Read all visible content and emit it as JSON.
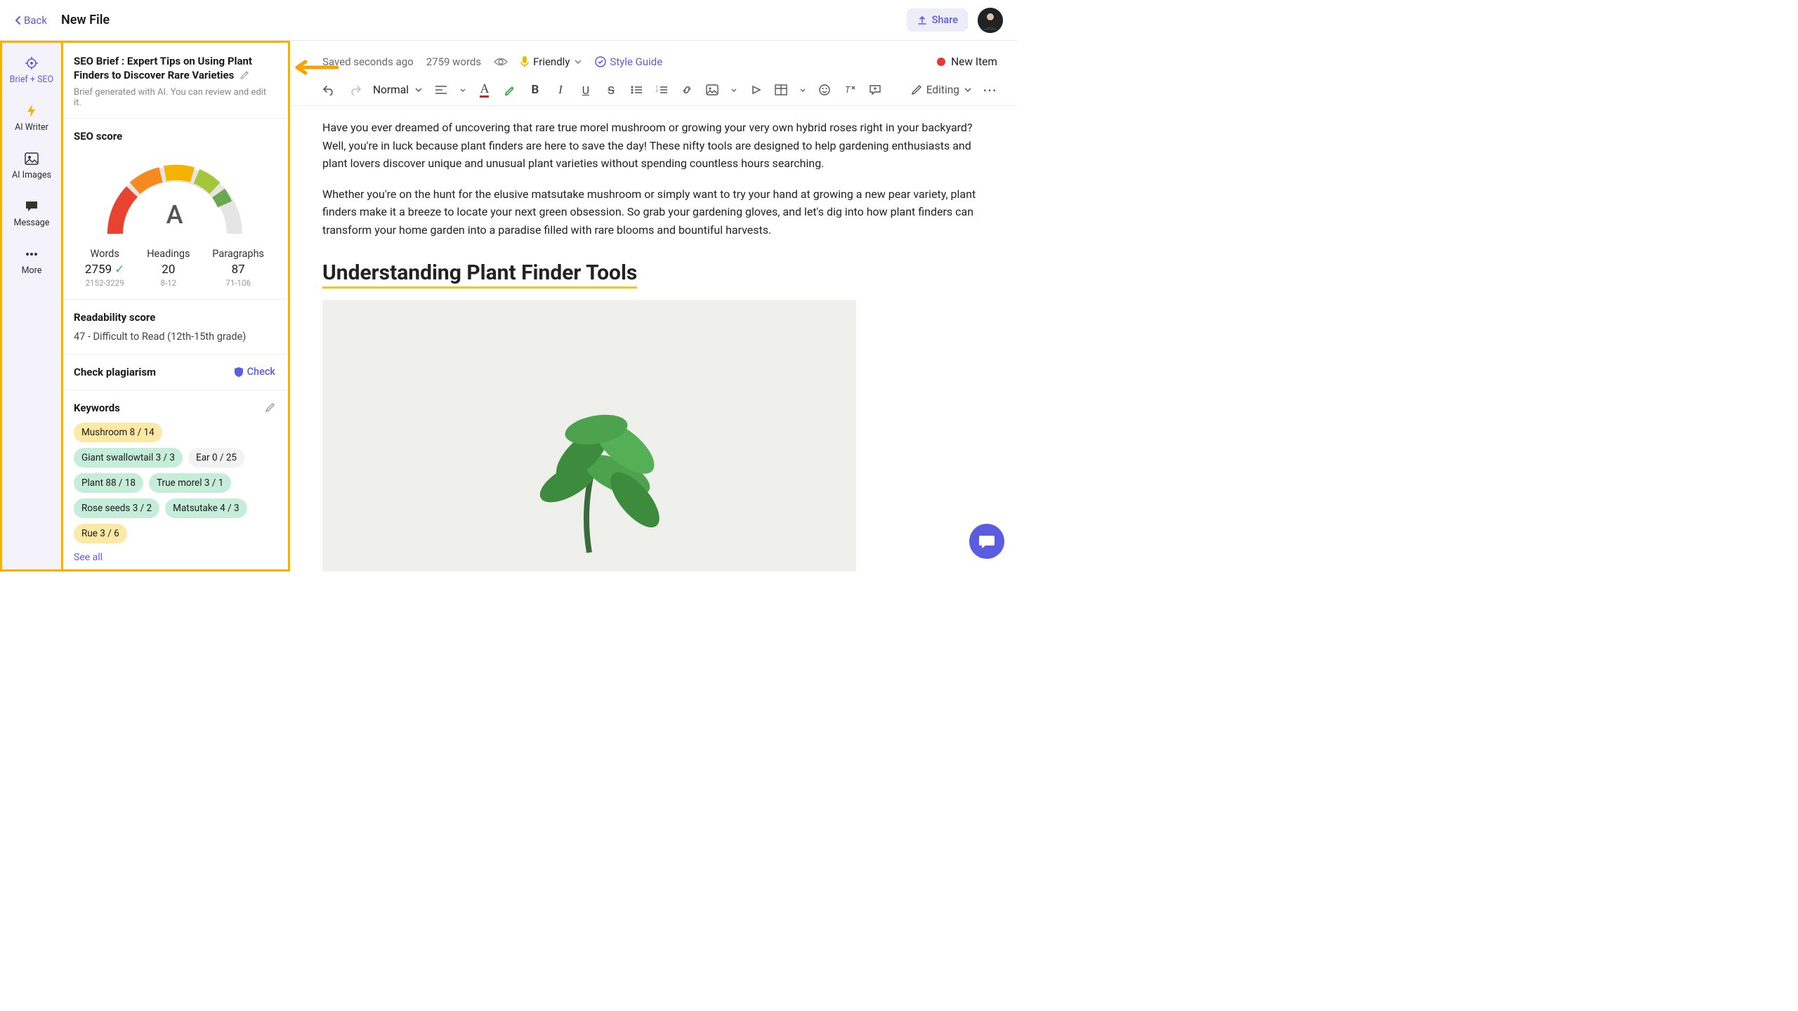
{
  "header": {
    "back": "Back",
    "title": "New File",
    "share": "Share"
  },
  "rail": {
    "items": [
      {
        "label": "Brief + SEO"
      },
      {
        "label": "AI Writer"
      },
      {
        "label": "AI Images"
      },
      {
        "label": "Message"
      },
      {
        "label": "More"
      }
    ]
  },
  "brief": {
    "title": "SEO Brief : Expert Tips on Using Plant Finders to Discover Rare Varieties",
    "sub": "Brief generated with AI. You can review and edit it."
  },
  "seo": {
    "title": "SEO score",
    "grade": "A",
    "stats": {
      "words": {
        "label": "Words",
        "value": "2759",
        "range": "2152-3229",
        "ok": true
      },
      "headings": {
        "label": "Headings",
        "value": "20",
        "range": "8-12"
      },
      "paragraphs": {
        "label": "Paragraphs",
        "value": "87",
        "range": "71-106"
      }
    }
  },
  "readability": {
    "title": "Readability score",
    "value": "47 - Difficult to Read (12th-15th grade)"
  },
  "plagiarism": {
    "title": "Check plagiarism",
    "action": "Check"
  },
  "keywords": {
    "title": "Keywords",
    "items": [
      {
        "text": "Mushroom",
        "count": "8 / 14",
        "cls": "kw-o"
      },
      {
        "text": "Giant swallowtail",
        "count": "3 / 3",
        "cls": "kw-g"
      },
      {
        "text": "Ear",
        "count": "0 / 25",
        "cls": "kw-n"
      },
      {
        "text": "Plant",
        "count": "88 / 18",
        "cls": "kw-g"
      },
      {
        "text": "True morel",
        "count": "3 / 1",
        "cls": "kw-g"
      },
      {
        "text": "Rose seeds",
        "count": "3 / 2",
        "cls": "kw-g"
      },
      {
        "text": "Matsutake",
        "count": "4 / 3",
        "cls": "kw-g"
      },
      {
        "text": "Rue",
        "count": "3 / 6",
        "cls": "kw-o"
      }
    ],
    "see_all": "See all"
  },
  "status": {
    "saved": "Saved seconds ago",
    "words": "2759 words",
    "tone": "Friendly",
    "style": "Style Guide",
    "new_item": "New Item"
  },
  "toolbar": {
    "format": "Normal",
    "mode": "Editing"
  },
  "content": {
    "p1": "Have you ever dreamed of uncovering that rare true morel mushroom or growing your very own hybrid roses right in your backyard? Well, you're in luck because plant finders are here to save the day! These nifty tools are designed to help gardening enthusiasts and plant lovers discover unique and unusual plant varieties without spending countless hours searching.",
    "p2": "Whether you're on the hunt for the elusive matsutake mushroom or simply want to try your hand at growing a new pear variety, plant finders make it a breeze to locate your next green obsession. So grab your gardening gloves, and let's dig into how plant finders can transform your home garden into a paradise filled with rare blooms and bountiful harvests.",
    "h2": "Understanding Plant Finder Tools"
  }
}
